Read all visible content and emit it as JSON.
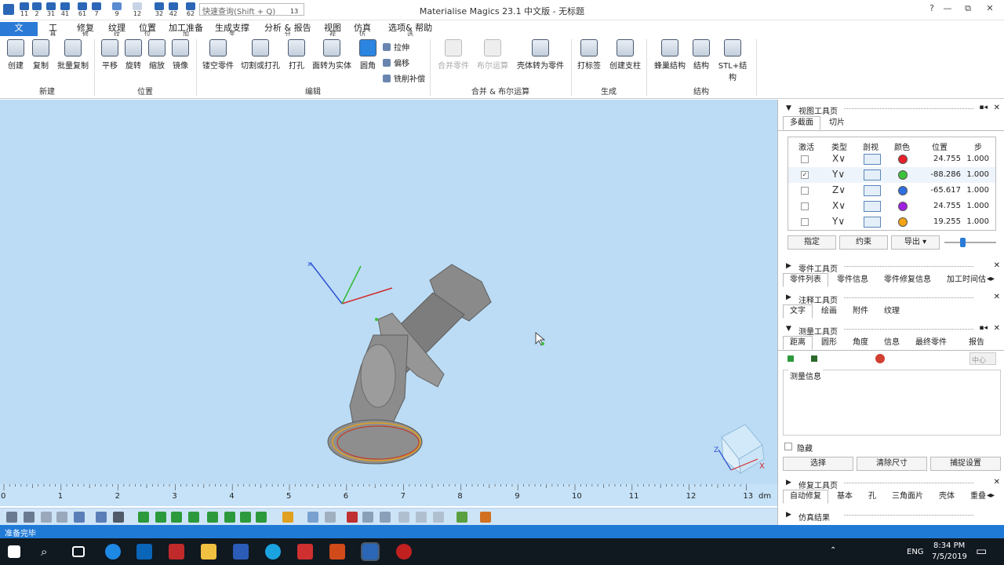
{
  "window": {
    "title": "Materialise Magics 23.1 中文版 - 无标题",
    "minimize": "—",
    "restore": "⧉",
    "close": "✕",
    "help_icon": "?"
  },
  "qat": [
    "11",
    "2",
    "31",
    "41",
    "61",
    "7",
    "9",
    "12",
    "32",
    "42",
    "62"
  ],
  "search": {
    "placeholder": "快速查询(Shift + Q)",
    "badge": "13"
  },
  "tabs": [
    {
      "label": "文",
      "key": ""
    },
    {
      "label": "工",
      "key": "具"
    },
    {
      "label": "修复",
      "key": "修"
    },
    {
      "label": "纹理",
      "key": "纹"
    },
    {
      "label": "位置",
      "key": "位"
    },
    {
      "label": "加工准备",
      "key": "加"
    },
    {
      "label": "生成支撑",
      "key": "生"
    },
    {
      "label": "分析 & 报告",
      "key": "分"
    },
    {
      "label": "视图",
      "key": "视"
    },
    {
      "label": "仿真",
      "key": "仿"
    },
    {
      "label": "选项& 帮助",
      "key": "选"
    }
  ],
  "ribbon": {
    "new": {
      "label": "新建",
      "items": [
        "创建",
        "复制",
        "批量复制"
      ]
    },
    "position": {
      "label": "位置",
      "items": [
        "平移",
        "旋转",
        "缩放",
        "镜像"
      ]
    },
    "edit": {
      "label": "编辑",
      "items": [
        "镂空零件",
        "切割或打孔",
        "打孔",
        "面转为实体",
        "圆角"
      ],
      "small": [
        "拉伸",
        "偏移",
        "铣削补偿"
      ]
    },
    "boolean": {
      "label": "合并 & 布尔运算",
      "items": [
        "合并零件",
        "布尔运算",
        "壳体转为零件"
      ]
    },
    "generate": {
      "label": "生成",
      "items": [
        "打标签",
        "创建支柱"
      ]
    },
    "structure": {
      "label": "结构",
      "items": [
        "蜂巢结构",
        "结构",
        "STL+结构"
      ]
    }
  },
  "ruler": {
    "ticks": [
      "0",
      "1",
      "2",
      "3",
      "4",
      "5",
      "6",
      "7",
      "8",
      "9",
      "10",
      "11",
      "12",
      "13"
    ],
    "unit": "dm"
  },
  "panel": {
    "view_tools": {
      "title": "视图工具页",
      "tabs": [
        "多截面",
        "切片"
      ],
      "columns": [
        "激活",
        "类型",
        "剖视",
        "颜色",
        "位置",
        "步"
      ],
      "rows": [
        {
          "active": false,
          "type": "X",
          "color": "#e8202a",
          "position": "24.755",
          "step": "1.000"
        },
        {
          "active": true,
          "type": "Y",
          "color": "#3cc23c",
          "position": "-88.286",
          "step": "1.000"
        },
        {
          "active": false,
          "type": "Z",
          "color": "#2f6fe0",
          "position": "-65.617",
          "step": "1.000"
        },
        {
          "active": false,
          "type": "X",
          "color": "#a020e0",
          "position": "24.755",
          "step": "1.000"
        },
        {
          "active": false,
          "type": "Y",
          "color": "#f5a414",
          "position": "19.255",
          "step": "1.000"
        }
      ],
      "check_mark": "✓",
      "buttons": [
        "指定",
        "约束",
        "导出"
      ],
      "slider_value": 0.35
    },
    "part_tools": {
      "title": "零件工具页",
      "tabs": [
        "零件列表",
        "零件信息",
        "零件修复信息",
        "加工时间估"
      ]
    },
    "annotation_tools": {
      "title": "注释工具页",
      "tabs": [
        "文字",
        "绘画",
        "附件",
        "纹理"
      ]
    },
    "measure_tools": {
      "title": "测量工具页",
      "tabs": [
        "距离",
        "圆形",
        "角度",
        "信息",
        "最终零件",
        "报告"
      ],
      "center_field": "中心",
      "info_label": "测量信息",
      "hide_label": "隐藏",
      "buttons": [
        "选择",
        "清除尺寸",
        "捕捉设置"
      ]
    },
    "repair_tools": {
      "title": "修复工具页",
      "tabs": [
        "自动修复",
        "基本",
        "孔",
        "三角面片",
        "壳体",
        "重叠"
      ]
    },
    "sim_results": {
      "title": "仿真结果"
    }
  },
  "status": {
    "text": "准备完毕"
  },
  "taskbar": {
    "lang": "ENG",
    "time": "8:34 PM",
    "date": "7/5/2019",
    "search_icon": "⌕",
    "notify_icon": "▭",
    "up_arrow": "⌃"
  },
  "viewcube": {
    "x_label": "X",
    "z_label": "Z"
  }
}
